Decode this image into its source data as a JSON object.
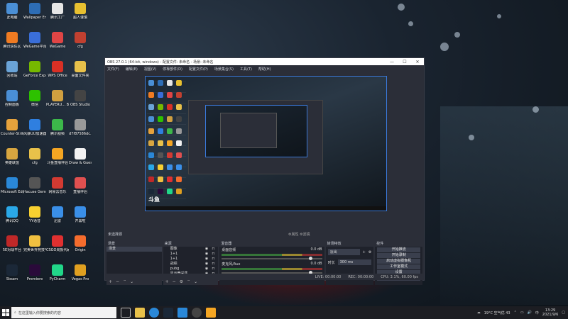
{
  "desktop": {
    "icons": [
      {
        "label": "此电脑",
        "color": "#4a8fd6"
      },
      {
        "label": "Wallpaper Engine:...",
        "color": "#2d6db5"
      },
      {
        "label": "腾讯工厂",
        "color": "#e6e6e6"
      },
      {
        "label": "超人谨慎",
        "color": "#e8c030"
      },
      {
        "label": "腾讯信任区",
        "color": "#f07b22"
      },
      {
        "label": "WeGame平台",
        "color": "#3a6ed8"
      },
      {
        "label": "WeGame",
        "color": "#e04545"
      },
      {
        "label": "cfg",
        "color": "#c14030"
      },
      {
        "label": "回收站",
        "color": "#6aa4d8"
      },
      {
        "label": "GeForce Experience",
        "color": "#76b900"
      },
      {
        "label": "WPS Office",
        "color": "#d93025"
      },
      {
        "label": "桌面文件夹",
        "color": "#e8c14a"
      },
      {
        "label": "控制面板",
        "color": "#4a8fd6"
      },
      {
        "label": "微信",
        "color": "#2dc100"
      },
      {
        "label": "PLAYERU... BATTLEGR...",
        "color": "#d1a040"
      },
      {
        "label": "OBS Studio",
        "color": "#444"
      },
      {
        "label": "Counter-Strike Global Off...",
        "color": "#e6a23c"
      },
      {
        "label": "风暴UU加速器",
        "color": "#2f7fe0"
      },
      {
        "label": "腾讯视频",
        "color": "#3cb84a"
      },
      {
        "label": "d7f87586dc...",
        "color": "#999"
      },
      {
        "label": "英雄联盟",
        "color": "#d8a640"
      },
      {
        "label": "cfg",
        "color": "#e8c14a"
      },
      {
        "label": "斗鱼直播伴侣",
        "color": "#f5a623"
      },
      {
        "label": "Draw & Guess",
        "color": "#f2f2f2"
      },
      {
        "label": "Microsoft Edge",
        "color": "#2a88d8"
      },
      {
        "label": "Hacuse Gemi...",
        "color": "#555"
      },
      {
        "label": "网易云音乐",
        "color": "#d33a32"
      },
      {
        "label": "直播伴侣",
        "color": "#e05050"
      },
      {
        "label": "腾讯QQ",
        "color": "#2aa8e8"
      },
      {
        "label": "YY语音",
        "color": "#f8d030"
      },
      {
        "label": "迅雷",
        "color": "#3a8fe8"
      },
      {
        "label": "开黑啦",
        "color": "#3a8fe8"
      },
      {
        "label": "5E对战平台",
        "color": "#c02828"
      },
      {
        "label": "完美世界竞技平台",
        "color": "#f0c040"
      },
      {
        "label": "CSGO周报代刷",
        "color": "#e03030"
      },
      {
        "label": "Origin",
        "color": "#f56c2d"
      },
      {
        "label": "Steam",
        "color": "#1b2838"
      },
      {
        "label": "Premiere",
        "color": "#2a0a3a"
      },
      {
        "label": "PyCharm",
        "color": "#21d789"
      },
      {
        "label": "Vegas Pro",
        "color": "#e0a020"
      }
    ]
  },
  "obs": {
    "title": "OBS 27.0.1 (64-bit, windows) - 配置文件: 未命名 - 场景: 未命名",
    "window_controls": [
      "—",
      "☐",
      "✕"
    ],
    "menu": [
      "文件(F)",
      "编辑(E)",
      "视图(V)",
      "停靠部件(D)",
      "配置文件(P)",
      "场景集合(S)",
      "工具(T)",
      "帮助(H)"
    ],
    "toolbar_label": "未选择源",
    "toolbar_mid": "⚙属性  ⚙滤镜",
    "docks": {
      "scenes": {
        "title": "场景",
        "items": [
          "场景"
        ]
      },
      "sources": {
        "title": "来源",
        "items": [
          "图像",
          "1+1",
          "1+1",
          "战绩",
          "pubg",
          "显示器采集"
        ]
      },
      "mixer": {
        "title": "混音器",
        "tracks": [
          {
            "name": "桌面音频",
            "level": "0.0 dB"
          },
          {
            "name": "麦克风/Aux",
            "level": "0.0 dB"
          }
        ]
      },
      "transitions": {
        "title": "转场特效",
        "type": "淡出",
        "duration_label": "时长",
        "duration": "300 ms"
      },
      "controls": {
        "title": "控件",
        "buttons": [
          "开始推流",
          "开始录制",
          "启动虚拟摄像机",
          "工作室模式",
          "设置",
          "退出"
        ]
      }
    },
    "status": {
      "live": "LIVE: 00:00:00",
      "rec": "REC: 00:00:00",
      "cpu": "CPU: 3.1%, 60.00 fps"
    }
  },
  "taskbar": {
    "search_placeholder": "在这里输入你要搜索的内容",
    "weather": "19°C 空气优 43",
    "time": "13:29",
    "date": "2021/9/6",
    "ime": "中"
  }
}
